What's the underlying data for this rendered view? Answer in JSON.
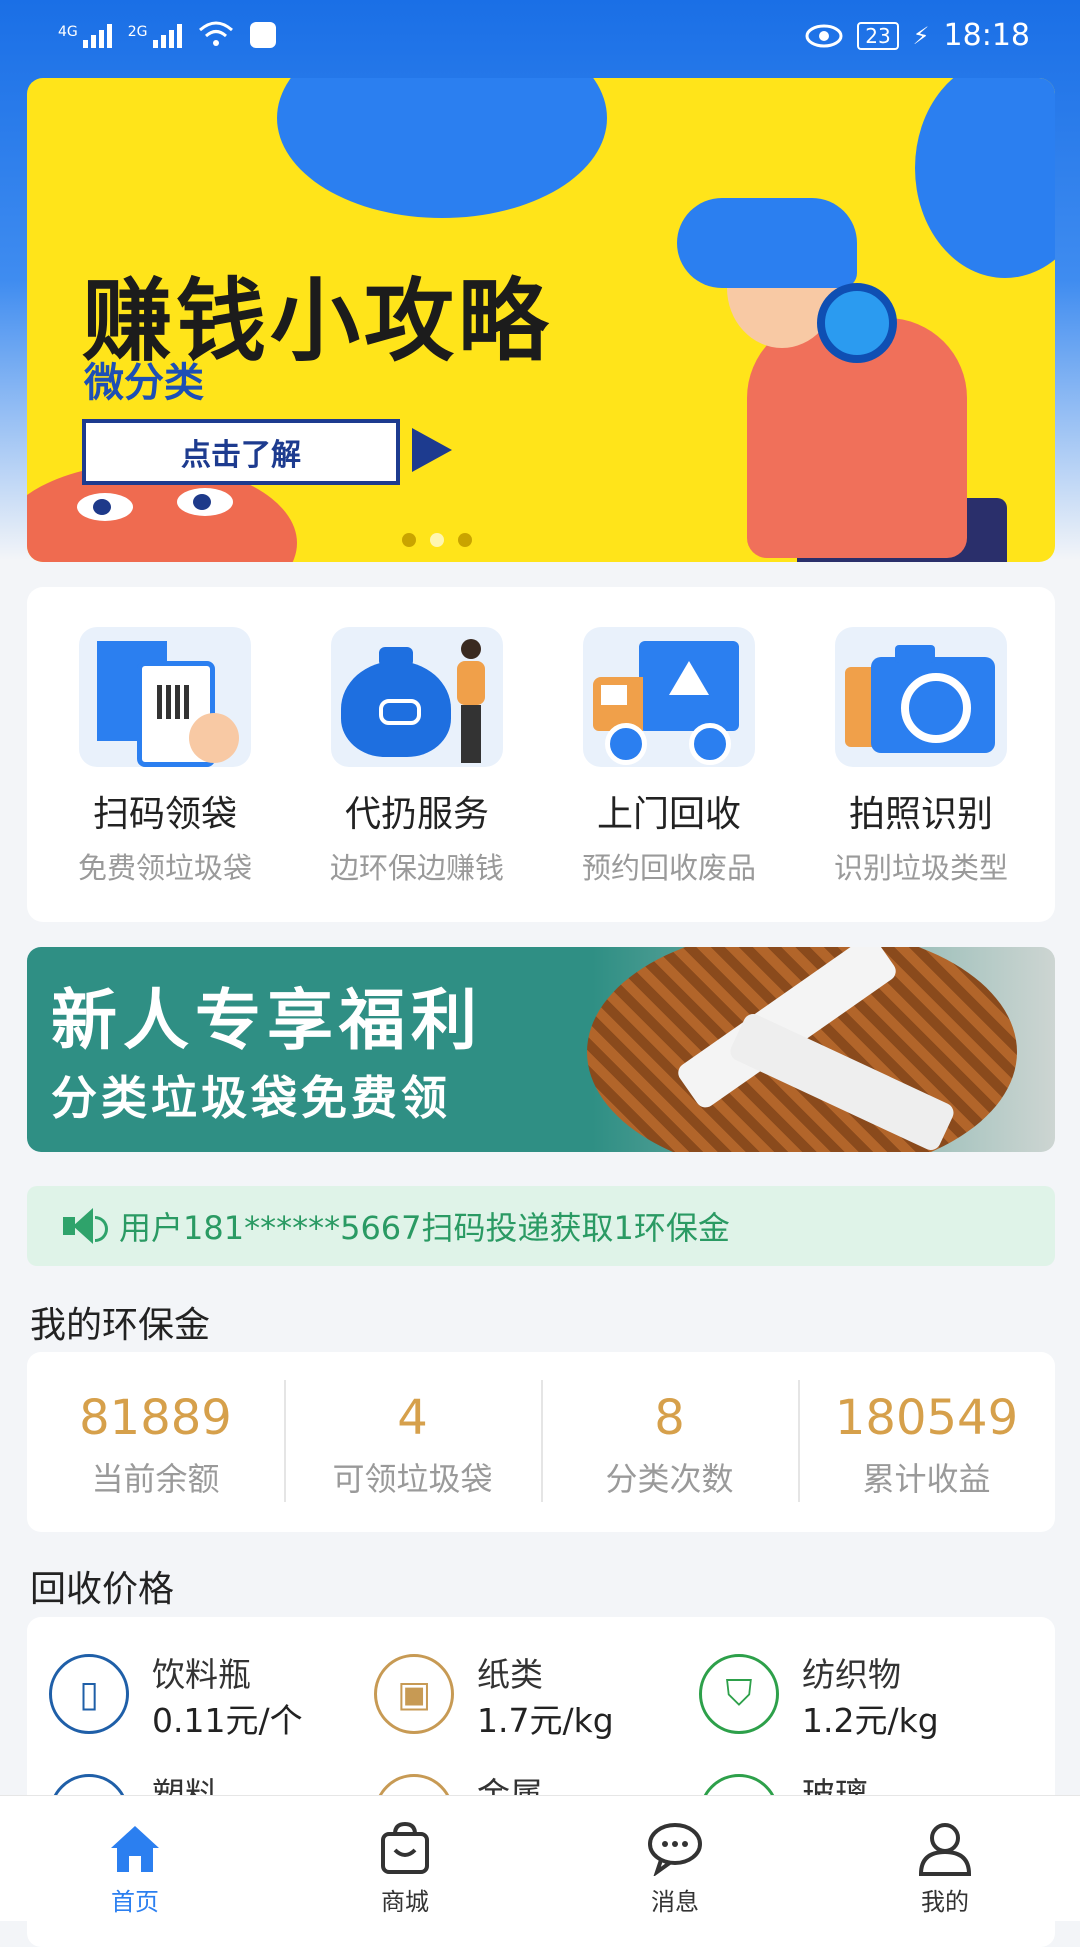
{
  "status_bar": {
    "sim1": "4G",
    "sim2": "2G",
    "battery": "23",
    "time": "18:18"
  },
  "banner": {
    "title": "赚钱小攻略",
    "subtitle": "微分类",
    "button": "点击了解",
    "pages": 3,
    "active_page": 1
  },
  "services": [
    {
      "title": "扫码领袋",
      "subtitle": "免费领垃圾袋",
      "icon": "qr-scan-icon"
    },
    {
      "title": "代扔服务",
      "subtitle": "边环保边赚钱",
      "icon": "money-bag-icon"
    },
    {
      "title": "上门回收",
      "subtitle": "预约回收废品",
      "icon": "truck-icon"
    },
    {
      "title": "拍照识别",
      "subtitle": "识别垃圾类型",
      "icon": "camera-icon"
    }
  ],
  "promo": {
    "line1": "新人专享福利",
    "line2": "分类垃圾袋免费领"
  },
  "notice": {
    "text": "用户181******5667扫码投递获取1环保金"
  },
  "wallet": {
    "title": "我的环保金",
    "items": [
      {
        "value": "81889",
        "label": "当前余额"
      },
      {
        "value": "4",
        "label": "可领垃圾袋"
      },
      {
        "value": "8",
        "label": "分类次数"
      },
      {
        "value": "180549",
        "label": "累计收益"
      }
    ]
  },
  "prices": {
    "title": "回收价格",
    "items": [
      {
        "name": "饮料瓶",
        "price": "0.11元/个",
        "color": "#1f5fa8",
        "icon": "bottle-icon"
      },
      {
        "name": "纸类",
        "price": "1.7元/kg",
        "color": "#c79a54",
        "icon": "box-icon"
      },
      {
        "name": "纺织物",
        "price": "1.2元/kg",
        "color": "#2da04a",
        "icon": "clothes-icon"
      },
      {
        "name": "塑料",
        "price": "",
        "color": "#1f5fa8",
        "icon": "plastic-icon"
      },
      {
        "name": "金属",
        "price": "",
        "color": "#c79a54",
        "icon": "metal-icon"
      },
      {
        "name": "玻璃",
        "price": "",
        "color": "#2da04a",
        "icon": "glass-icon"
      }
    ]
  },
  "nav": {
    "items": [
      {
        "label": "首页",
        "icon": "home-icon",
        "active": true
      },
      {
        "label": "商城",
        "icon": "shop-bag-icon",
        "active": false
      },
      {
        "label": "消息",
        "icon": "chat-icon",
        "active": false
      },
      {
        "label": "我的",
        "icon": "user-icon",
        "active": false
      }
    ]
  },
  "colors": {
    "primary": "#2b7ff0",
    "accent_gold": "#d6a04b",
    "notice_green": "#2a9a63"
  }
}
